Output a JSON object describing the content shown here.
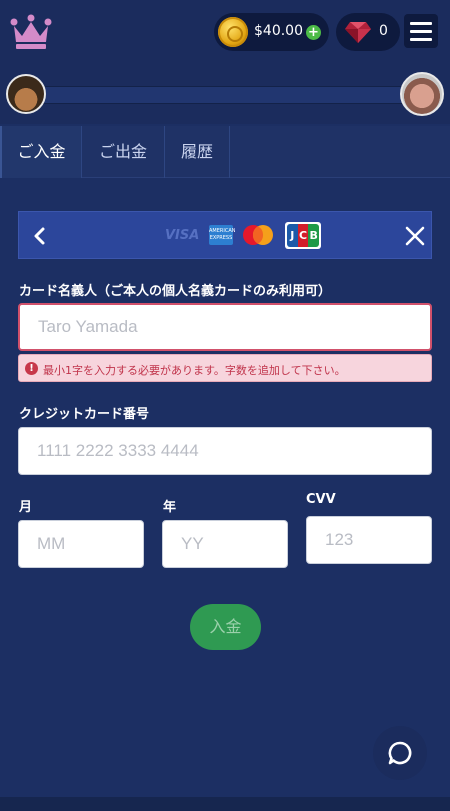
{
  "header": {
    "balance": "$40.00",
    "gems": "0"
  },
  "tabs": [
    {
      "label": "ご入金",
      "active": true
    },
    {
      "label": "ご出金",
      "active": false
    },
    {
      "label": "履歴",
      "active": false
    }
  ],
  "card_brands": {
    "visa": "VISA",
    "amex": "AMERICAN EXPRESS",
    "jcb": [
      "J",
      "C",
      "B"
    ]
  },
  "form": {
    "cardholder_label": "カード名義人（ご本人の個人名義カードのみ利用可）",
    "cardholder_placeholder": "Taro Yamada",
    "cardholder_error": "最小1字を入力する必要があります。字数を追加して下さい。",
    "card_number_label": "クレジットカード番号",
    "card_number_placeholder": "1111 2222 3333 4444",
    "month_label": "月",
    "month_placeholder": "MM",
    "year_label": "年",
    "year_placeholder": "YY",
    "cvv_label": "CVV",
    "cvv_placeholder": "123",
    "submit_label": "入金"
  },
  "colors": {
    "background": "#1c2f63",
    "card_header": "#2c469b",
    "error": "#c0334a",
    "submit": "#2f9a52"
  },
  "icons": [
    "crown-logo-icon",
    "coin-icon",
    "plus-icon",
    "gem-icon",
    "hamburger-menu-icon",
    "back-arrow-icon",
    "close-icon",
    "error-icon",
    "chat-icon"
  ]
}
